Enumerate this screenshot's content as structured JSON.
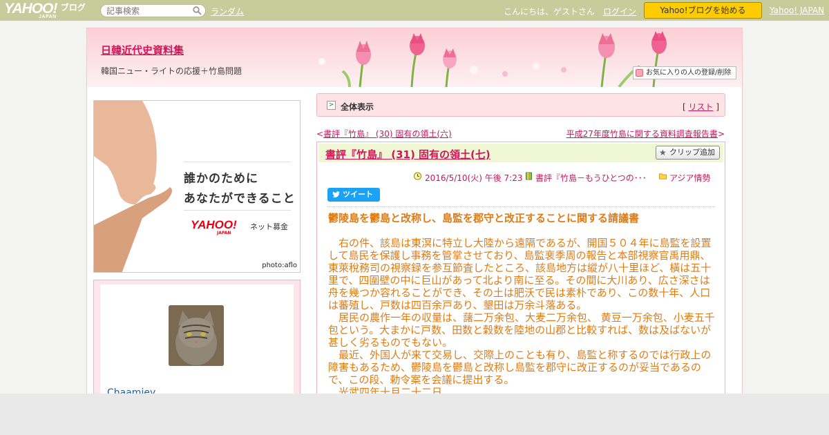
{
  "topbar": {
    "logo_main": "YAHOO!",
    "logo_sub": "JAPAN",
    "logo_blog": "ブログ",
    "search_placeholder": "記事検索",
    "random_link": "ランダム",
    "greeting": "こんにちは、ゲストさん",
    "login_link": "ログイン",
    "start_blog_button": "Yahoo!ブログを始める",
    "yahoo_japan_link": "Yahoo! JAPAN"
  },
  "header": {
    "blog_title": "日韓近代史資料集",
    "blog_description": "韓国ニュー・ライトの応援＋竹島問題",
    "favorite_button": "お気に入りの人の登録/削除"
  },
  "sidebar": {
    "ad": {
      "line1": "誰かのために",
      "line2": "あなたができること",
      "brand": "YAHOO!",
      "brand_sub": "JAPAN",
      "service": "ネット募金",
      "credit": "photo:aflo"
    },
    "profile": {
      "name": "Chaamiey"
    }
  },
  "main": {
    "view_all_label": "全体表示",
    "list_bracket_open": "[ ",
    "list_link": "リスト",
    "list_bracket_close": " ]",
    "prev_marker": "<",
    "prev_link": "書評『竹島』 (30) 固有の領土(六)",
    "next_link": "平成27年度竹島に関する資料調査報告書",
    "next_marker": ">",
    "article": {
      "title": "書評『竹島』 (31) 固有の領土(七)",
      "clip_button": "クリップ追加",
      "date": "2016/5/10(火) 午後 7:23",
      "book_category": "書評『竹島－もうひとつの･･･",
      "folder_category": "アジア情勢",
      "tweet_button": "ツイート",
      "heading": "鬱陵島を鬱島と改称し、島監を郡守と改正することに関する請議書",
      "paragraphs": [
        "右の件、該島は東溟に特立し大陸から遠隔であるが、開国５０４年に島監を設置して島民を保護し事務を管掌させており、島監裵季周の報告と本部視察官禹用鼎、東萊稅務司の視察録を参互節査したところ、該島地方は縱が八十里ほど、橫は五十里で、四圍壁の中に巨山があって北より南に至る。その間に大川あり、広さ深さは舟を幾つか容れることができ、その土は肥沃で民は素朴であり、この数十年、人口は蕃殖し、戸数は四百余戸あり、墾田は万余斗落ある。",
        "居民の農作一年の収量は、藷二万余包、大麦二万余包、 黄豆一万余包、小麦五千包という。大まかに戸数、田数と穀数を陸地の山郡と比較すれば、数は及ばないが甚しく劣るものでもない。",
        "最近、外国人が来て交易し、交際上のことも有り、島監と称するのでは行政上の障害もあるため、鬱陵島を鬱島と改称し島監を郡守に改正するのが妥当であるので、この段、勅令案を会議に提出する。",
        "光武四年十月二十二日"
      ]
    }
  },
  "colors": {
    "topbar": "#c6cc9a",
    "title_pink": "#d4145a",
    "body_orange": "#e07b13",
    "start_button": "#ffcc00"
  }
}
